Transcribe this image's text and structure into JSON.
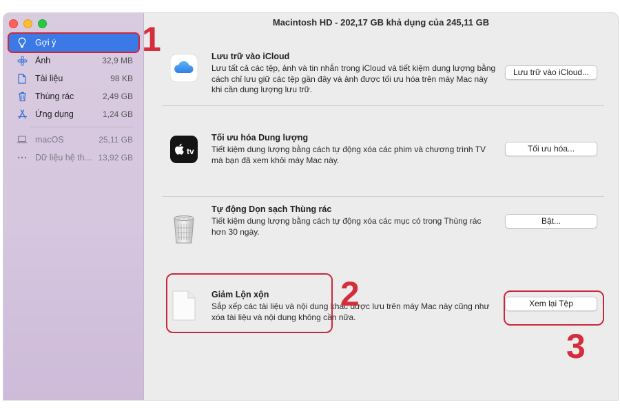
{
  "window": {
    "title": "Macintosh HD - 202,17 GB khả dụng của 245,11 GB"
  },
  "sidebar": {
    "items": [
      {
        "label": "Gợi ý",
        "size": "",
        "icon": "lightbulb-icon",
        "selected": true
      },
      {
        "label": "Ảnh",
        "size": "32,9 MB",
        "icon": "flower-icon"
      },
      {
        "label": "Tài liệu",
        "size": "98 KB",
        "icon": "document-icon"
      },
      {
        "label": "Thùng rác",
        "size": "2,49 GB",
        "icon": "trash-icon"
      },
      {
        "label": "Ứng dụng",
        "size": "1,24 GB",
        "icon": "app-store-icon"
      }
    ],
    "volumes": [
      {
        "label": "macOS",
        "size": "25,11 GB",
        "icon": "laptop-icon"
      },
      {
        "label": "Dữ liệu hệ th...",
        "size": "13,92 GB",
        "icon": "ellipsis-icon"
      }
    ]
  },
  "recommendations": [
    {
      "title": "Lưu trữ vào iCloud",
      "desc": "Lưu tất cả các tệp, ảnh và tin nhắn trong iCloud và tiết kiệm dung lượng bằng cách chỉ lưu giữ các tệp gần đây và ảnh được tối ưu hóa trên máy Mac này khi cần dung lượng lưu trữ.",
      "button": "Lưu trữ vào iCloud...",
      "icon": "icloud-icon"
    },
    {
      "title": "Tối ưu hóa Dung lượng",
      "desc": "Tiết kiệm dung lượng bằng cách tự động xóa các phim và chương trình TV mà bạn đã xem khỏi máy Mac này.",
      "button": "Tối ưu hóa...",
      "icon": "apple-tv-icon"
    },
    {
      "title": "Tự động Dọn sạch Thùng rác",
      "desc": "Tiết kiệm dung lượng bằng cách tự động xóa các mục có trong Thùng rác hơn 30 ngày.",
      "button": "Bật...",
      "icon": "trash-can-icon"
    },
    {
      "title": "Giảm Lộn xộn",
      "desc": "Sắp xếp các tài liệu và nội dung khác được lưu trên máy Mac này cũng như xóa tài liệu và nội dung không cần nữa.",
      "button": "Xem lại Tệp",
      "icon": "blank-document-icon"
    }
  ],
  "annotations": {
    "step1": "1",
    "step2": "2",
    "step3": "3",
    "color": "#d62d3c"
  },
  "colors": {
    "selection": "#3b79e6",
    "sidebar": "#d8c9df",
    "content": "#ececec"
  }
}
